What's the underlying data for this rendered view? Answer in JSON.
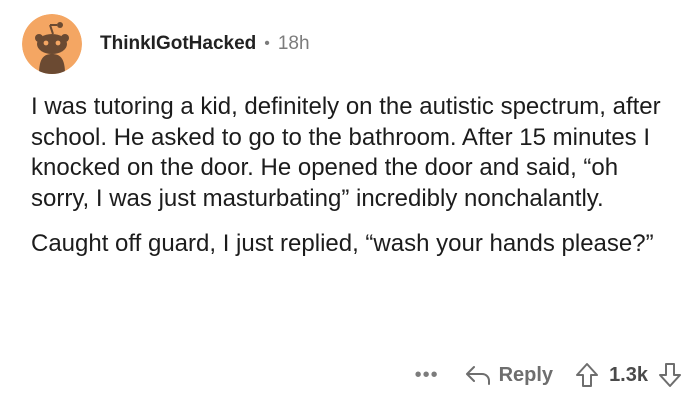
{
  "comment": {
    "username": "ThinkIGotHacked",
    "separator": "•",
    "time": "18h",
    "paragraphs": [
      "I was tutoring a kid, definitely on the autistic spectrum, after school.  He asked to go to the bathroom.  After 15 minutes I knocked on the door.  He opened the door and said, “oh sorry, I was just masturbating” incredibly nonchalantly.",
      "Caught off guard, I just replied, “wash your hands please?”"
    ]
  },
  "actions": {
    "more": "•••",
    "reply_label": "Reply",
    "score": "1.3k"
  },
  "icons": {
    "avatar": "reddit-snoo-avatar-icon",
    "reply": "reply-arrow-icon",
    "upvote": "upvote-arrow-icon",
    "downvote": "downvote-arrow-icon"
  },
  "colors": {
    "avatar_bg": "#f4a663",
    "text": "#1c1c1c",
    "muted": "#7c7c7c"
  }
}
